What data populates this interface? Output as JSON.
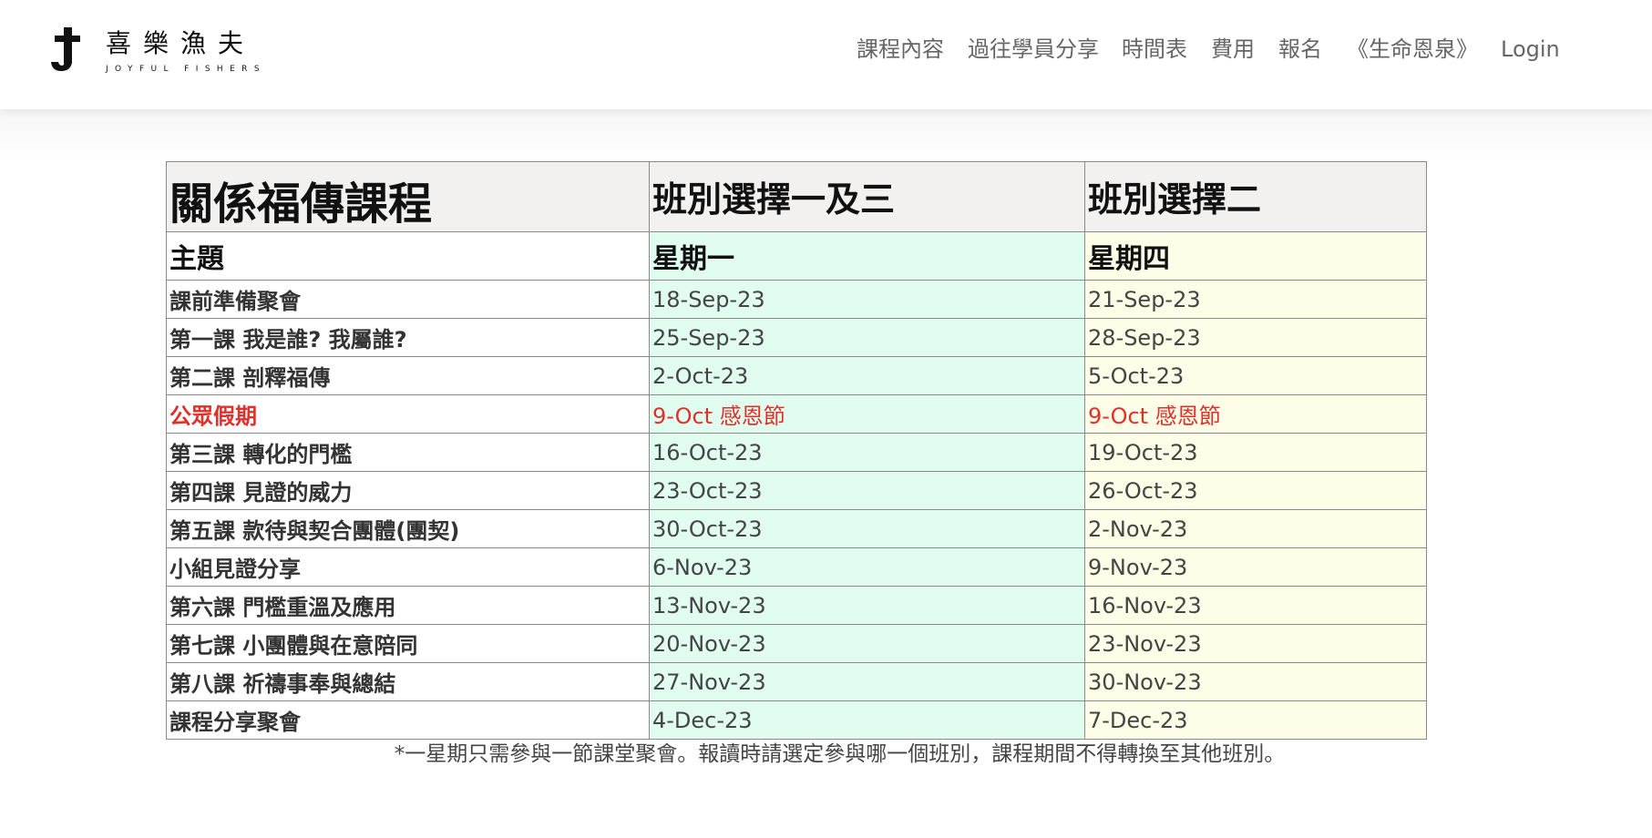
{
  "brand": {
    "name_cn": "喜樂漁夫",
    "name_en": "JOYFUL FISHERS",
    "icon": "cross-hook-logo-icon"
  },
  "nav": {
    "items": [
      "課程內容",
      "過往學員分享",
      "時間表",
      "費用",
      "報名",
      "《生命恩泉》",
      "Login"
    ]
  },
  "schedule": {
    "headers": [
      "關係福傳課程",
      "班別選擇一及三",
      "班別選擇二"
    ],
    "day_headers": [
      "主題",
      "星期一",
      "星期四"
    ],
    "rows": [
      {
        "topic": "課前準備聚會",
        "mon": "18-Sep-23",
        "thu": "21-Sep-23"
      },
      {
        "topic": "第一課 我是誰? 我屬誰?",
        "mon": "25-Sep-23",
        "thu": "28-Sep-23"
      },
      {
        "topic": "第二課 剖釋福傳",
        "mon": "2-Oct-23",
        "thu": "5-Oct-23"
      },
      {
        "topic": "公眾假期",
        "mon": "9-Oct 感恩節",
        "thu": "9-Oct 感恩節"
      },
      {
        "topic": "第三課 轉化的門檻",
        "mon": "16-Oct-23",
        "thu": "19-Oct-23"
      },
      {
        "topic": "第四課 見證的威力",
        "mon": "23-Oct-23",
        "thu": "26-Oct-23"
      },
      {
        "topic": "第五課 款待與契合團體(團契)",
        "mon": "30-Oct-23",
        "thu": "2-Nov-23"
      },
      {
        "topic": "小組見證分享",
        "mon": "6-Nov-23",
        "thu": "9-Nov-23"
      },
      {
        "topic": "第六課 門檻重溫及應用",
        "mon": "13-Nov-23",
        "thu": "16-Nov-23"
      },
      {
        "topic": "第七課 小團體與在意陪同",
        "mon": "20-Nov-23",
        "thu": "23-Nov-23"
      },
      {
        "topic": "第八課 祈禱事奉與總結",
        "mon": "27-Nov-23",
        "thu": "30-Nov-23"
      },
      {
        "topic": "課程分享聚會",
        "mon": "4-Dec-23",
        "thu": "7-Dec-23"
      }
    ],
    "note": "*一星期只需參與一節課堂聚會。報讀時請選定參與哪一個班別，課程期間不得轉換至其他班別。"
  },
  "colors": {
    "monday_bg": "#e1fdf0",
    "thursday_bg": "#fefde8",
    "holiday_text": "#e0302a",
    "header_bg": "#f2f1f0"
  }
}
